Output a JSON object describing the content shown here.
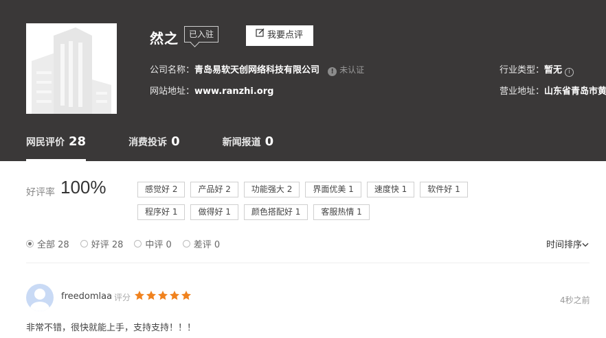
{
  "company": {
    "name": "然之",
    "badge": "已入驻",
    "review_button": "我要点评",
    "company_label": "公司名称：",
    "company_value": "青岛易软天创网络科技有限公司",
    "unverified": "未认证",
    "website_label": "网站地址：",
    "website_value": "www.ranzhi.org",
    "industry_label": "行业类型：",
    "industry_value": "暂无",
    "address_label": "营业地址：",
    "address_value": "山东省青岛市黄"
  },
  "tabs": [
    {
      "label": "网民评价",
      "count": "28"
    },
    {
      "label": "消费投诉",
      "count": "0"
    },
    {
      "label": "新闻报道",
      "count": "0"
    }
  ],
  "rating": {
    "label": "好评率",
    "value": "100%"
  },
  "tags": [
    "感觉好 2",
    "产品好 2",
    "功能强大 2",
    "界面优美 1",
    "速度快 1",
    "软件好 1",
    "程序好 1",
    "做得好 1",
    "颜色搭配好 1",
    "客服热情 1"
  ],
  "filters": [
    {
      "label": "全部 28",
      "checked": true
    },
    {
      "label": "好评 28",
      "checked": false
    },
    {
      "label": "中评 0",
      "checked": false
    },
    {
      "label": "差评 0",
      "checked": false
    }
  ],
  "sort_label": "时间排序",
  "review": {
    "username": "freedomlaa",
    "score_label": "评分",
    "stars": 5,
    "time": "4秒之前",
    "text": "非常不错，很快就能上手，支持支持！！！"
  },
  "colors": {
    "header_bg": "#3a3838",
    "star": "#f0821e"
  }
}
